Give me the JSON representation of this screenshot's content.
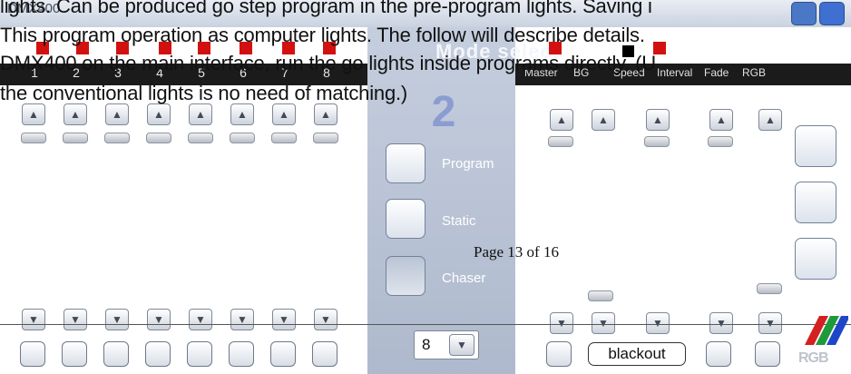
{
  "app": {
    "title": "DMX400"
  },
  "channels": {
    "labels": [
      "1",
      "2",
      "3",
      "4",
      "5",
      "6",
      "7",
      "8"
    ]
  },
  "mode_select": {
    "title": "Mode select",
    "number": "2",
    "modes": [
      "Program",
      "Static",
      "Chaser"
    ]
  },
  "master_panel": {
    "labels": [
      "Master",
      "BG",
      "Speed",
      "Interval",
      "Fade",
      "RGB"
    ]
  },
  "controls": {
    "count_value": "8",
    "blackout_label": "blackout",
    "logo_text": "RGB"
  },
  "document": {
    "lines": [
      "lights. Can be produced go step program in the pre-program lights. Saving i",
      "This program operation as computer lights. The follow will describe details.",
      "DMX400 on the main interface, run the go lights inside programs directly. (U",
      "the conventional lights is no need of matching.)"
    ],
    "page_number": "Page 13 of 16"
  },
  "colors": {
    "header_bar": "#1b1b1b",
    "indicator_red": "#d31010",
    "mode_panel": "#aeb9cd"
  }
}
